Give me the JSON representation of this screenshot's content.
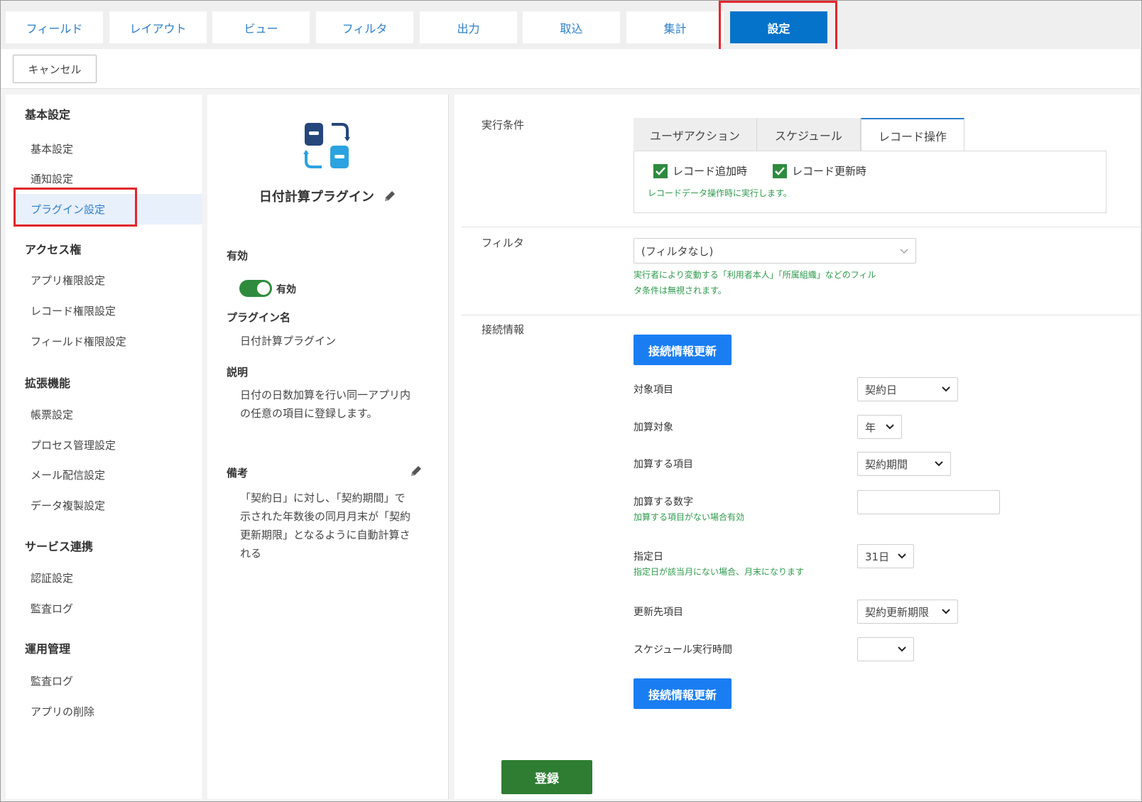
{
  "top_tabs": [
    {
      "label": "フィールド"
    },
    {
      "label": "レイアウト"
    },
    {
      "label": "ビュー"
    },
    {
      "label": "フィルタ"
    },
    {
      "label": "出力"
    },
    {
      "label": "取込"
    },
    {
      "label": "集計"
    },
    {
      "label": "設定",
      "active": true
    }
  ],
  "toolbar": {
    "cancel_label": "キャンセル"
  },
  "sidebar": {
    "sections": [
      {
        "heading": "基本設定",
        "items": [
          "基本設定",
          "通知設定",
          "プラグイン設定"
        ]
      },
      {
        "heading": "アクセス権",
        "items": [
          "アプリ権限設定",
          "レコード権限設定",
          "フィールド権限設定"
        ]
      },
      {
        "heading": "拡張機能",
        "items": [
          "帳票設定",
          "プロセス管理設定",
          "メール配信設定",
          "データ複製設定"
        ]
      },
      {
        "heading": "サービス連携",
        "items": [
          "認証設定",
          "監査ログ"
        ]
      },
      {
        "heading": "運用管理",
        "items": [
          "監査ログ",
          "アプリの削除"
        ]
      }
    ],
    "active_item": "プラグイン設定"
  },
  "plugin": {
    "title": "日付計算プラグイン",
    "enabled_label": "有効",
    "enabled_toggle_text": "有効",
    "enabled": true,
    "name_label": "プラグイン名",
    "name_value": "日付計算プラグイン",
    "description_label": "説明",
    "description_line1": "日付の日数加算を行い同一アプリ内",
    "description_line2": "の任意の項目に登録します。",
    "notes_label": "備考",
    "notes_line1": "「契約日」に対し、「契約期間」で",
    "notes_line2": "示された年数後の同月月末が「契約",
    "notes_line3": "更新期限」となるように自動計算さ",
    "notes_line4": "れる"
  },
  "execution": {
    "label": "実行条件",
    "tabs": [
      "ユーザアクション",
      "スケジュール",
      "レコード操作"
    ],
    "active_tab": "レコード操作",
    "checkbox_add": "レコード追加時",
    "checkbox_update": "レコード更新時",
    "note": "レコードデータ操作時に実行します。"
  },
  "filter": {
    "label": "フィルタ",
    "selected": "(フィルタなし)",
    "note_line1": "実行者により変動する「利用者本人」「所属組織」などのフィル",
    "note_line2": "タ条件は無視されます。"
  },
  "connection": {
    "label": "接続情報",
    "update_button": "接続情報更新",
    "fields": {
      "target_label": "対象項目",
      "target_value": "契約日",
      "add_target_label": "加算対象",
      "add_target_value": "年",
      "add_field_label": "加算する項目",
      "add_field_value": "契約期間",
      "add_number_label": "加算する数字",
      "add_number_value": "",
      "add_number_note": "加算する項目がない場合有効",
      "day_label": "指定日",
      "day_value": "31日",
      "day_note": "指定日が該当月にない場合、月末になります",
      "dest_label": "更新先項目",
      "dest_value": "契約更新期限",
      "schedule_label": "スケジュール実行時間",
      "schedule_value": ""
    }
  },
  "register_button": "登録",
  "colors": {
    "accent_blue": "#0473c9",
    "highlight_red": "#e3262c",
    "green": "#2e8b3e"
  }
}
